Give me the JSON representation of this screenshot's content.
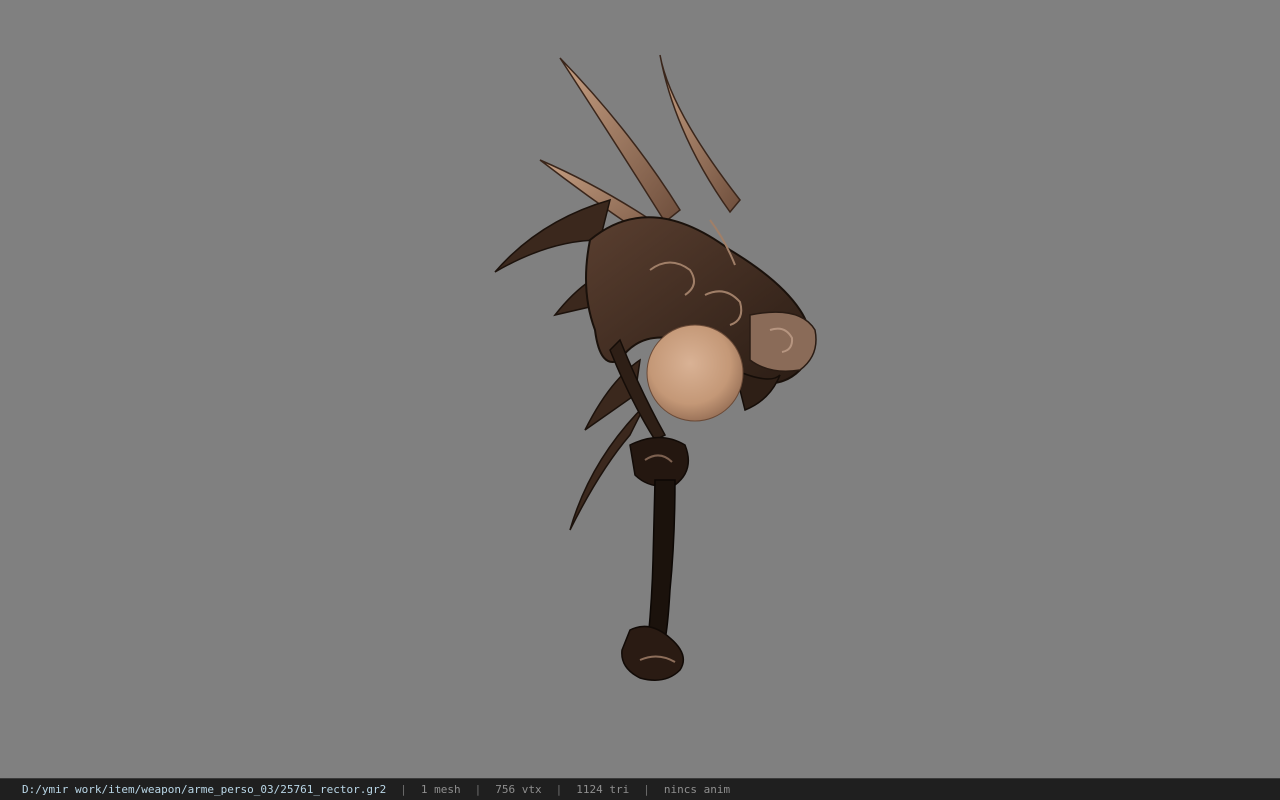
{
  "viewer": {
    "background_color": "#808080",
    "model_icon": "dragon-head-staff-model"
  },
  "status": {
    "file_path": "D:/ymir work/item/weapon/arme_perso_03/25761_rector.gr2",
    "separator": "|",
    "mesh_count": "1 mesh",
    "vertex_count": "756 vtx",
    "triangle_count": "1124 tri",
    "animation": "nincs anim"
  }
}
